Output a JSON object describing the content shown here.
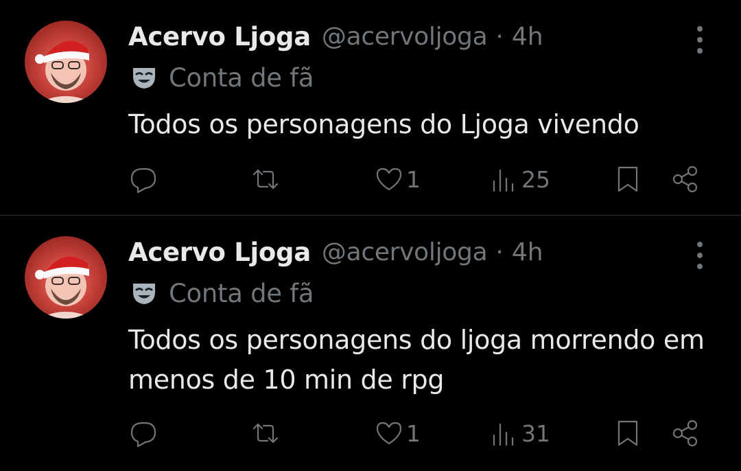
{
  "tweets": [
    {
      "name": "Acervo Ljoga",
      "handle": "@acervoljoga",
      "separator": "·",
      "time": "4h",
      "label": "Conta de fã",
      "text": "Todos os personagens do Ljoga vivendo",
      "reply_count": "",
      "retweet_count": "",
      "like_count": "1",
      "view_count": "25"
    },
    {
      "name": "Acervo Ljoga",
      "handle": "@acervoljoga",
      "separator": "·",
      "time": "4h",
      "label": "Conta de fã",
      "text": "Todos os personagens do ljoga morrendo em menos de 10 min de rpg",
      "reply_count": "",
      "retweet_count": "",
      "like_count": "1",
      "view_count": "31"
    }
  ],
  "colors": {
    "background": "#000000",
    "text": "#e7e9ea",
    "muted": "#71767b",
    "divider": "#2f3336"
  },
  "icons": [
    "more-icon",
    "theater-mask-icon",
    "reply-icon",
    "retweet-icon",
    "like-icon",
    "views-icon",
    "bookmark-icon",
    "share-icon"
  ]
}
